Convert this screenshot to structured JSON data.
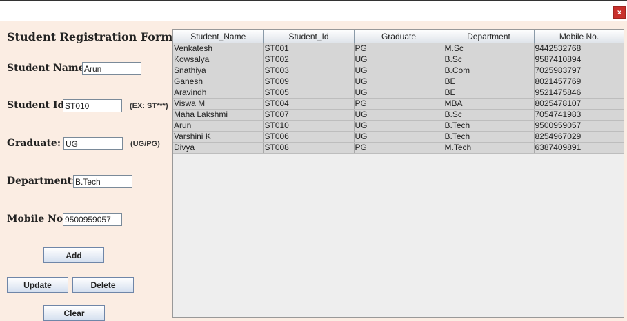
{
  "window": {
    "close_label": "x"
  },
  "form": {
    "title": "Student Registration Form",
    "student_name_label": "Student Name:",
    "student_name_value": "Arun",
    "student_id_label": "Student Id:",
    "student_id_value": "ST010",
    "student_id_hint": "(EX: ST***)",
    "graduate_label": "Graduate:",
    "graduate_value": "UG",
    "graduate_hint": "(UG/PG)",
    "department_label": "Department:",
    "department_value": "B.Tech",
    "mobile_label": "Mobile No:",
    "mobile_value": "9500959057",
    "add_label": "Add",
    "update_label": "Update",
    "delete_label": "Delete",
    "clear_label": "Clear"
  },
  "table": {
    "headers": [
      "Student_Name",
      "Student_Id",
      "Graduate",
      "Department",
      "Mobile No."
    ],
    "rows": [
      [
        "Venkatesh",
        "ST001",
        "PG",
        "M.Sc",
        "9442532768"
      ],
      [
        "Kowsalya",
        "ST002",
        "UG",
        "B.Sc",
        "9587410894"
      ],
      [
        "Snathiya",
        "ST003",
        "UG",
        "B.Com",
        "7025983797"
      ],
      [
        "Ganesh",
        "ST009",
        "UG",
        "BE",
        "8021457769"
      ],
      [
        "Aravindh",
        "ST005",
        "UG",
        "BE",
        "9521475846"
      ],
      [
        "Viswa M",
        "ST004",
        "PG",
        "MBA",
        "8025478107"
      ],
      [
        "Maha Lakshmi",
        "ST007",
        "UG",
        "B.Sc",
        "7054741983"
      ],
      [
        "Arun",
        "ST010",
        "UG",
        "B.Tech",
        "9500959057"
      ],
      [
        "Varshini K",
        "ST006",
        "UG",
        "B.Tech",
        "8254967029"
      ],
      [
        "Divya",
        "ST008",
        "PG",
        "M.Tech",
        "6387409891"
      ]
    ]
  }
}
